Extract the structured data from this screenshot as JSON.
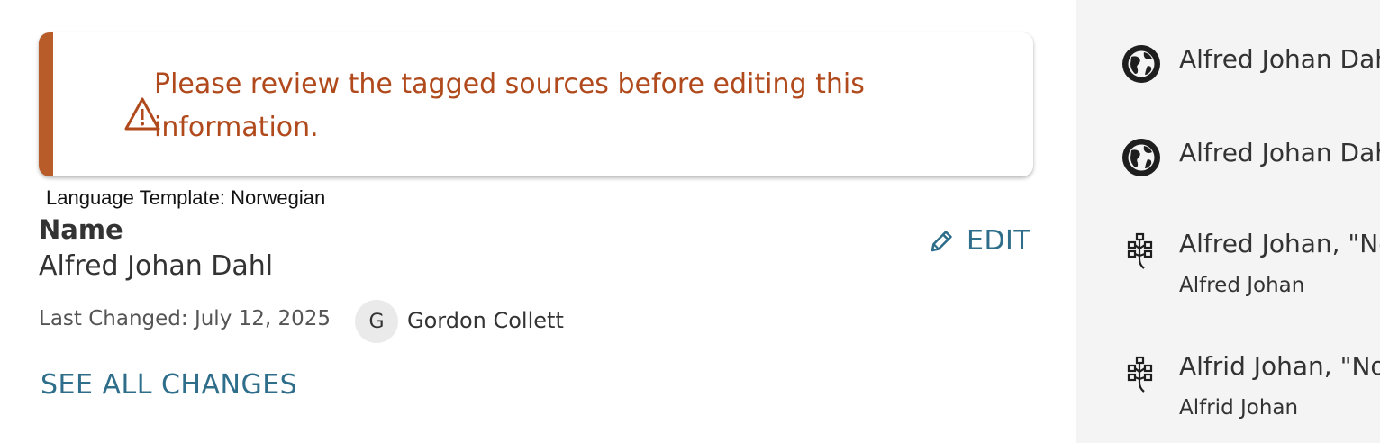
{
  "alert": {
    "message": "Please review the tagged sources before editing this information.",
    "icon": "warning-triangle-icon",
    "accent_color": "#b85c2a",
    "text_color": "#b04a1c"
  },
  "language_template": "Language Template: Norwegian",
  "name_section": {
    "label": "Name",
    "value": "Alfred Johan Dahl",
    "edit_label": "EDIT",
    "last_changed": "Last Changed: July 12, 2025",
    "contributor_initial": "G",
    "contributor_name": "Gordon Collett",
    "see_all_label": "SEE ALL CHANGES",
    "link_color": "#2e6e8a"
  },
  "sources": [
    {
      "icon": "globe-icon",
      "title": "Alfred Johan Dah",
      "subtitle": ""
    },
    {
      "icon": "globe-icon",
      "title": "Alfred Johan Dah",
      "subtitle": ""
    },
    {
      "icon": "family-tree-icon",
      "title": "Alfred Johan, \"No",
      "subtitle": "Alfred Johan"
    },
    {
      "icon": "family-tree-icon",
      "title": "Alfrid Johan, \"Nor",
      "subtitle": "Alfrid Johan"
    }
  ]
}
